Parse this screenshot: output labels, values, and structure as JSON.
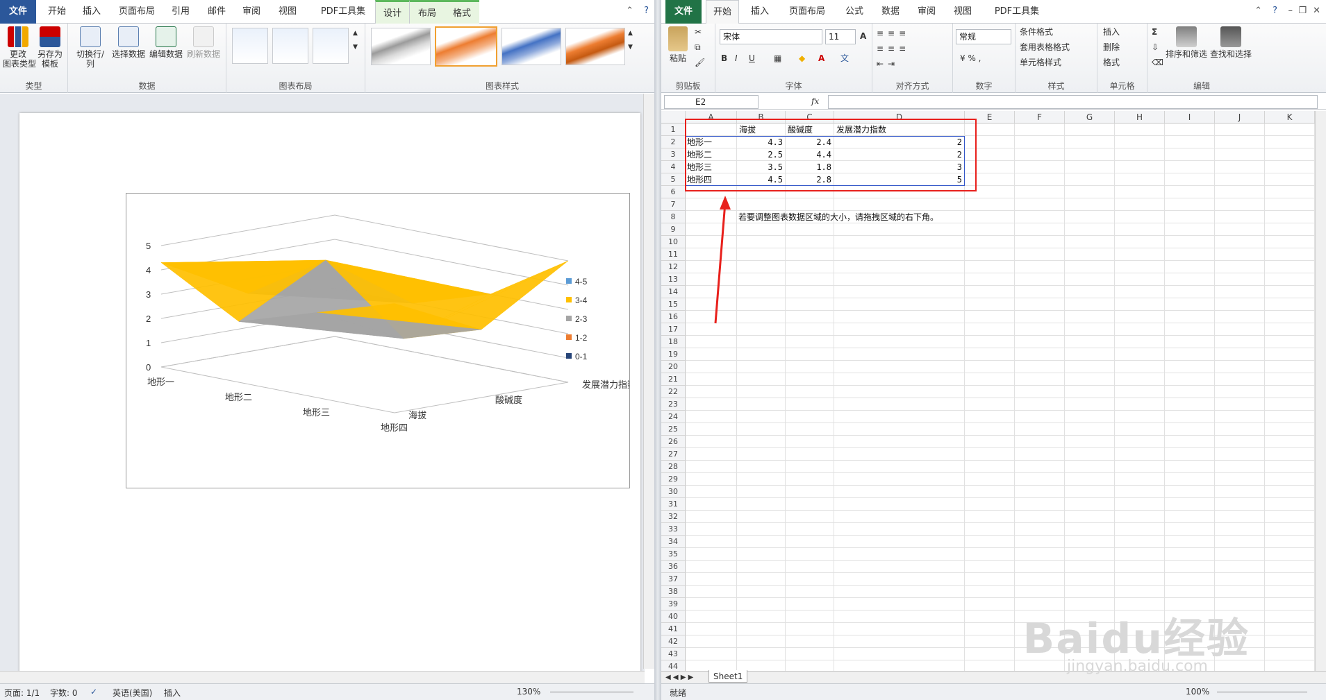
{
  "word": {
    "tabs": [
      "文件",
      "开始",
      "插入",
      "页面布局",
      "引用",
      "邮件",
      "审阅",
      "视图",
      "PDF工具集",
      "设计",
      "布局",
      "格式"
    ],
    "groups": {
      "type": {
        "name": "类型",
        "buttons": [
          "更改\n图表类型",
          "另存为\n模板"
        ]
      },
      "data": {
        "name": "数据",
        "buttons": [
          "切换行/列",
          "选择数据",
          "编辑数据",
          "刷新数据"
        ]
      },
      "layout": {
        "name": "图表布局"
      },
      "styles": {
        "name": "图表样式"
      }
    },
    "status": {
      "page": "页面: 1/1",
      "words": "字数: 0",
      "lang": "英语(美国)",
      "mode": "插入",
      "zoom": "130%"
    }
  },
  "excel": {
    "tabs": [
      "文件",
      "开始",
      "插入",
      "页面布局",
      "公式",
      "数据",
      "审阅",
      "视图",
      "PDF工具集"
    ],
    "ribbon": {
      "clipboard": {
        "name": "剪贴板",
        "paste": "粘贴"
      },
      "font": {
        "name": "字体",
        "family": "宋体",
        "size": "11"
      },
      "align": {
        "name": "对齐方式"
      },
      "number": {
        "name": "数字",
        "format": "常规"
      },
      "styles": {
        "name": "样式",
        "items": [
          "条件格式",
          "套用表格格式",
          "单元格样式"
        ]
      },
      "cells": {
        "name": "单元格",
        "items": [
          "插入",
          "删除",
          "格式"
        ]
      },
      "edit": {
        "name": "编辑",
        "items": [
          "排序和筛选",
          "查找和选择"
        ]
      }
    },
    "namebox": "E2",
    "fx": "fx",
    "columns": [
      "A",
      "B",
      "C",
      "D",
      "E",
      "F",
      "G",
      "H",
      "I",
      "J",
      "K"
    ],
    "header_row": [
      "",
      "海拔",
      "酸碱度",
      "发展潜力指数"
    ],
    "rows": [
      [
        "地形一",
        "4.3",
        "2.4",
        "2"
      ],
      [
        "地形二",
        "2.5",
        "4.4",
        "2"
      ],
      [
        "地形三",
        "3.5",
        "1.8",
        "3"
      ],
      [
        "地形四",
        "4.5",
        "2.8",
        "5"
      ]
    ],
    "note": "若要调整图表数据区域的大小，请拖拽区域的右下角。",
    "sheet": "Sheet1",
    "status": {
      "ready": "就绪",
      "zoom": "100%"
    },
    "watermark": "Baidu经验",
    "watermark_url": "jingyan.baidu.com"
  },
  "chart_data": {
    "type": "surface",
    "categories": [
      "地形一",
      "地形二",
      "地形三",
      "地形四"
    ],
    "series": [
      {
        "name": "海拔",
        "values": [
          4.3,
          2.5,
          3.5,
          4.5
        ]
      },
      {
        "name": "酸碱度",
        "values": [
          2.4,
          4.4,
          1.8,
          2.8
        ]
      },
      {
        "name": "发展潜力指数",
        "values": [
          2,
          2,
          3,
          5
        ]
      }
    ],
    "z_ticks": [
      "0",
      "1",
      "2",
      "3",
      "4",
      "5"
    ],
    "legend": [
      {
        "label": "4-5",
        "color": "#5b9bd5"
      },
      {
        "label": "3-4",
        "color": "#ffc000"
      },
      {
        "label": "2-3",
        "color": "#a5a5a5"
      },
      {
        "label": "1-2",
        "color": "#ed7d31"
      },
      {
        "label": "0-1",
        "color": "#264478"
      }
    ],
    "legend_position": "right"
  }
}
